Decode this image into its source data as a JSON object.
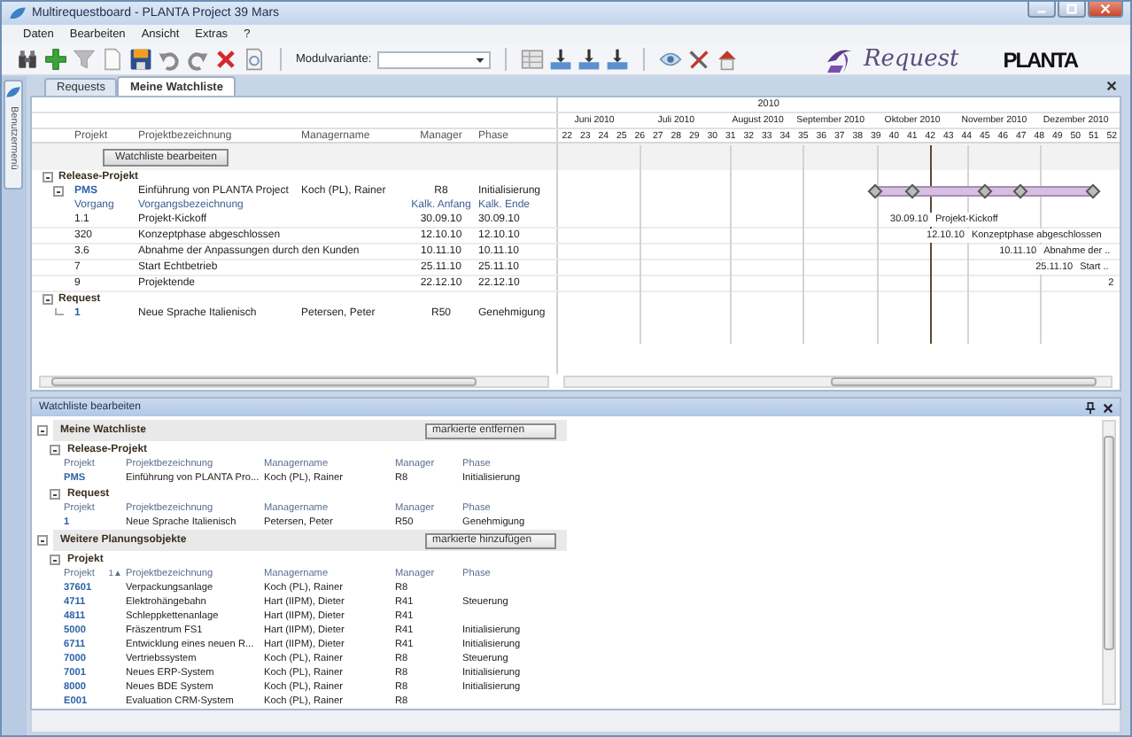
{
  "window": {
    "title": "Multirequestboard - PLANTA Project 39 Mars"
  },
  "menu": [
    {
      "label": "Daten"
    },
    {
      "label": "Bearbeiten"
    },
    {
      "label": "Ansicht"
    },
    {
      "label": "Extras"
    },
    {
      "label": "?"
    }
  ],
  "toolbar": {
    "variant_label": "Modulvariante:"
  },
  "logos": {
    "request": "Request",
    "planta": "PLANTA"
  },
  "side_tab": {
    "label": "Benutzermenü"
  },
  "tabs": [
    {
      "label": "Requests",
      "selected": false
    },
    {
      "label": "Meine Watchliste",
      "selected": true
    }
  ],
  "grid": {
    "columns": [
      "Projekt",
      "Projektbezeichnung",
      "Managername",
      "Manager",
      "Phase"
    ],
    "edit_button": "Watchliste bearbeiten",
    "groups": [
      {
        "title": "Release-Projekt",
        "expanded": true,
        "items": [
          {
            "id": "PMS",
            "name": "Einführung von PLANTA Project",
            "manager_name": "Koch (PL), Rainer",
            "manager": "R8",
            "phase": "Initialisierung",
            "expanded": true,
            "sub_columns": [
              "Vorgang",
              "Vorgangsbezeichnung",
              "Kalk. Anfang",
              "Kalk. Ende"
            ],
            "tasks": [
              {
                "id": "1.1",
                "name": "Projekt-Kickoff",
                "start": "30.09.10",
                "end": "30.09.10",
                "gantt_date": "30.09.10",
                "gantt_name": "Projekt-Kickoff"
              },
              {
                "id": "320",
                "name": "Konzeptphase abgeschlossen",
                "start": "12.10.10",
                "end": "12.10.10",
                "gantt_date": "12.10.10",
                "gantt_name": "Konzeptphase abgeschlossen"
              },
              {
                "id": "3.6",
                "name": "Abnahme der Anpassungen durch den Kunden",
                "start": "10.11.10",
                "end": "10.11.10",
                "gantt_date": "10.11.10",
                "gantt_name": "Abnahme der .."
              },
              {
                "id": "7",
                "name": "Start Echtbetrieb",
                "start": "25.11.10",
                "end": "25.11.10",
                "gantt_date": "25.11.10",
                "gantt_name": "Start .."
              },
              {
                "id": "9",
                "name": "Projektende",
                "start": "22.12.10",
                "end": "22.12.10",
                "gantt_date": "2"
              }
            ]
          }
        ]
      },
      {
        "title": "Request",
        "expanded": true,
        "items": [
          {
            "id": "1",
            "name": "Neue Sprache Italienisch",
            "manager_name": "Petersen, Peter",
            "manager": "R50",
            "phase": "Genehmigung"
          }
        ]
      }
    ]
  },
  "gantt": {
    "year": "2010",
    "months": [
      {
        "label": "Juni 2010",
        "weeks": [
          {
            "label": "22",
            "milestone": false,
            "today": false
          },
          {
            "label": "23",
            "milestone": false,
            "today": false
          },
          {
            "label": "24",
            "milestone": false,
            "today": false
          },
          {
            "label": "25",
            "milestone": false,
            "today": false
          }
        ]
      },
      {
        "label": "Juli 2010",
        "weeks": [
          {
            "label": "26",
            "milestone": false,
            "today": false
          },
          {
            "label": "27",
            "milestone": false,
            "today": false
          },
          {
            "label": "28",
            "milestone": false,
            "today": false
          },
          {
            "label": "29",
            "milestone": false,
            "today": false
          },
          {
            "label": "30",
            "milestone": false,
            "today": false
          }
        ]
      },
      {
        "label": "August 2010",
        "weeks": [
          {
            "label": "31",
            "milestone": false,
            "today": false
          },
          {
            "label": "32",
            "milestone": false,
            "today": false
          },
          {
            "label": "33",
            "milestone": false,
            "today": false
          },
          {
            "label": "34",
            "milestone": false,
            "today": false
          }
        ]
      },
      {
        "label": "September 2010",
        "weeks": [
          {
            "label": "35",
            "milestone": false,
            "today": false
          },
          {
            "label": "36",
            "milestone": false,
            "today": false
          },
          {
            "label": "37",
            "milestone": false,
            "today": false
          },
          {
            "label": "38",
            "milestone": false,
            "today": false
          }
        ]
      },
      {
        "label": "Oktober 2010",
        "weeks": [
          {
            "label": "39",
            "milestone": true,
            "today": false
          },
          {
            "label": "40",
            "milestone": false,
            "today": false
          },
          {
            "label": "41",
            "milestone": true,
            "today": false
          },
          {
            "label": "42",
            "milestone": false,
            "today": true
          },
          {
            "label": "43",
            "milestone": false,
            "today": false
          }
        ]
      },
      {
        "label": "November 2010",
        "weeks": [
          {
            "label": "44",
            "milestone": false,
            "today": false
          },
          {
            "label": "45",
            "milestone": true,
            "today": false
          },
          {
            "label": "46",
            "milestone": false,
            "today": false
          },
          {
            "label": "47",
            "milestone": true,
            "today": false
          }
        ]
      },
      {
        "label": "Dezember 2010",
        "weeks": [
          {
            "label": "48",
            "milestone": false,
            "today": false
          },
          {
            "label": "49",
            "milestone": false,
            "today": false
          },
          {
            "label": "50",
            "milestone": false,
            "today": false
          },
          {
            "label": "51",
            "milestone": true,
            "today": false
          },
          {
            "label": "52",
            "milestone": false,
            "today": false
          }
        ]
      }
    ]
  },
  "watchlist_panel": {
    "title": "Watchliste bearbeiten",
    "sections": [
      {
        "title": "Meine Watchliste",
        "button": "markierte entfernen",
        "expanded": true,
        "groups": [
          {
            "title": "Release-Projekt",
            "expanded": true,
            "columns": [
              "Projekt",
              "Projektbezeichnung",
              "Managername",
              "Manager",
              "Phase"
            ],
            "rows": [
              {
                "project": "PMS",
                "name": "Einführung von PLANTA Pro...",
                "manager_name": "Koch (PL), Rainer",
                "manager": "R8",
                "phase": "Initialisierung"
              }
            ]
          },
          {
            "title": "Request",
            "expanded": true,
            "columns": [
              "Projekt",
              "Projektbezeichnung",
              "Managername",
              "Manager",
              "Phase"
            ],
            "rows": [
              {
                "project": "1",
                "name": "Neue Sprache Italienisch",
                "manager_name": "Petersen, Peter",
                "manager": "R50",
                "phase": "Genehmigung"
              }
            ]
          }
        ]
      },
      {
        "title": "Weitere Planungsobjekte",
        "button": "markierte hinzufügen",
        "expanded": true,
        "groups": [
          {
            "title": "Projekt",
            "expanded": true,
            "sort_mark": "1▲",
            "columns": [
              "Projekt",
              "Projektbezeichnung",
              "Managername",
              "Manager",
              "Phase"
            ],
            "rows": [
              {
                "project": "37601",
                "name": "Verpackungsanlage",
                "manager_name": "Koch (PL), Rainer",
                "manager": "R8"
              },
              {
                "project": "4711",
                "name": "Elektrohängebahn",
                "manager_name": "Hart (IIPM), Dieter",
                "manager": "R41",
                "phase": "Steuerung"
              },
              {
                "project": "4811",
                "name": "Schleppkettenanlage",
                "manager_name": "Hart (IIPM), Dieter",
                "manager": "R41"
              },
              {
                "project": "5000",
                "name": "Fräszentrum FS1",
                "manager_name": "Hart (IIPM), Dieter",
                "manager": "R41",
                "phase": "Initialisierung"
              },
              {
                "project": "6711",
                "name": "Entwicklung eines neuen R...",
                "manager_name": "Hart (IIPM), Dieter",
                "manager": "R41",
                "phase": "Initialisierung"
              },
              {
                "project": "7000",
                "name": "Vertriebssystem",
                "manager_name": "Koch (PL), Rainer",
                "manager": "R8",
                "phase": "Steuerung"
              },
              {
                "project": "7001",
                "name": "Neues ERP-System",
                "manager_name": "Koch (PL), Rainer",
                "manager": "R8",
                "phase": "Initialisierung"
              },
              {
                "project": "8000",
                "name": "Neues BDE System",
                "manager_name": "Koch (PL), Rainer",
                "manager": "R8",
                "phase": "Initialisierung"
              },
              {
                "project": "E001",
                "name": "Evaluation CRM-System",
                "manager_name": "Koch (PL), Rainer",
                "manager": "R8"
              }
            ]
          }
        ]
      }
    ]
  }
}
